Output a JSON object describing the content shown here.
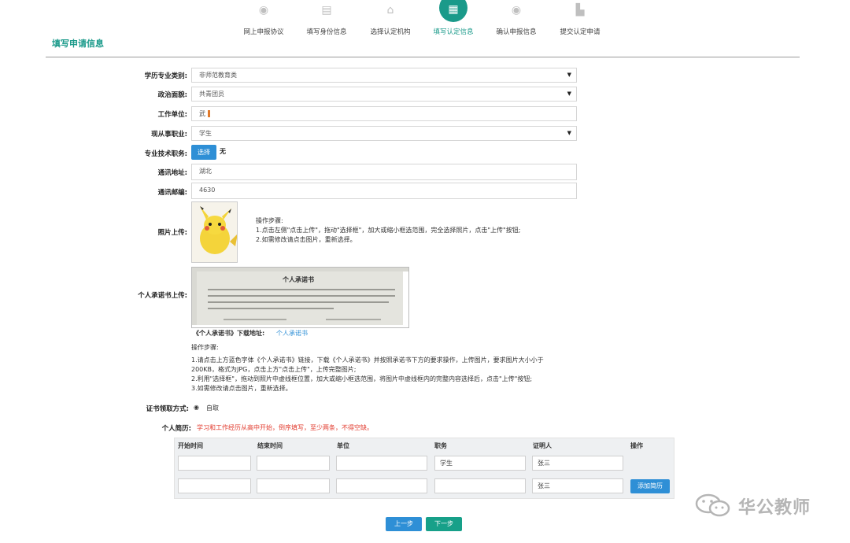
{
  "steps": [
    {
      "label": "网上申报协议",
      "icon": "eye-icon"
    },
    {
      "label": "填写身份信息",
      "icon": "document-icon"
    },
    {
      "label": "选择认定机构",
      "icon": "building-icon"
    },
    {
      "label": "填写认定信息",
      "icon": "form-icon",
      "active": true
    },
    {
      "label": "确认申报信息",
      "icon": "eye-icon"
    },
    {
      "label": "提交认定申请",
      "icon": "home-icon"
    }
  ],
  "page_title": "填写申请信息",
  "form": {
    "major_category": {
      "label": "学历专业类别:",
      "value": "非师范教育类"
    },
    "political_status": {
      "label": "政治面貌:",
      "value": "共青团员"
    },
    "work_unit": {
      "label": "工作单位:",
      "value": "武"
    },
    "occupation": {
      "label": "现从事职业:",
      "value": "学生"
    },
    "title": {
      "label": "专业技术职务:",
      "button": "选择",
      "value": "无"
    },
    "address": {
      "label": "通讯地址:",
      "value": "湖北"
    },
    "postcode": {
      "label": "通讯邮编:",
      "value": "4630"
    },
    "photo": {
      "label": "照片上传:"
    },
    "photo_steps": [
      "操作步骤:",
      "1.点击左侧\"点击上传\"，拖动\"选择框\"，加大或缩小框选范围，完全选择照片，点击\"上传\"按钮;",
      "2.如需修改请点击图片，重新选择。"
    ],
    "promise": {
      "label": "个人承诺书上传:",
      "doc_title": "个人承诺书"
    },
    "promise_download_label": "《个人承诺书》下载地址:",
    "promise_download_link": "个人承诺书",
    "promise_steps": [
      "操作步骤:",
      "1.请点击上方蓝色字体《个人承诺书》链接，下载《个人承诺书》并按照承诺书下方的要求操作，上传图片，要求图片大小小于",
      "200KB，格式为JPG，点击上方\"点击上传\"，上传完整图片;",
      "2.利用\"选择框\"，拖动到照片中虚线框位置，加大或缩小框选范围，将图片中虚线框内的完整内容选择后，点击\"上传\"按钮;",
      "3.如需修改请点击图片，重新选择。"
    ],
    "cert_method": {
      "label": "证书领取方式:",
      "option": "自取"
    },
    "resume": {
      "label": "个人简历:",
      "note": "学习和工作经历从高中开始，倒序填写，至少两条，不得空缺。"
    }
  },
  "resume_table": {
    "headers": [
      "开始时间",
      "结束时间",
      "单位",
      "职务",
      "证明人",
      "操作"
    ],
    "rows": [
      {
        "start": "",
        "end": "",
        "unit": "",
        "position": "学生",
        "witness": "张三",
        "action": ""
      },
      {
        "start": "",
        "end": "",
        "unit": "",
        "position": "",
        "witness": "张三",
        "action": "添加简历"
      }
    ]
  },
  "nav": {
    "prev": "上一步",
    "next": "下一步"
  },
  "watermark": "华公教师",
  "colors": {
    "accent": "#1a9a8a",
    "blue": "#2e8fd6",
    "note": "#e23b2e"
  }
}
